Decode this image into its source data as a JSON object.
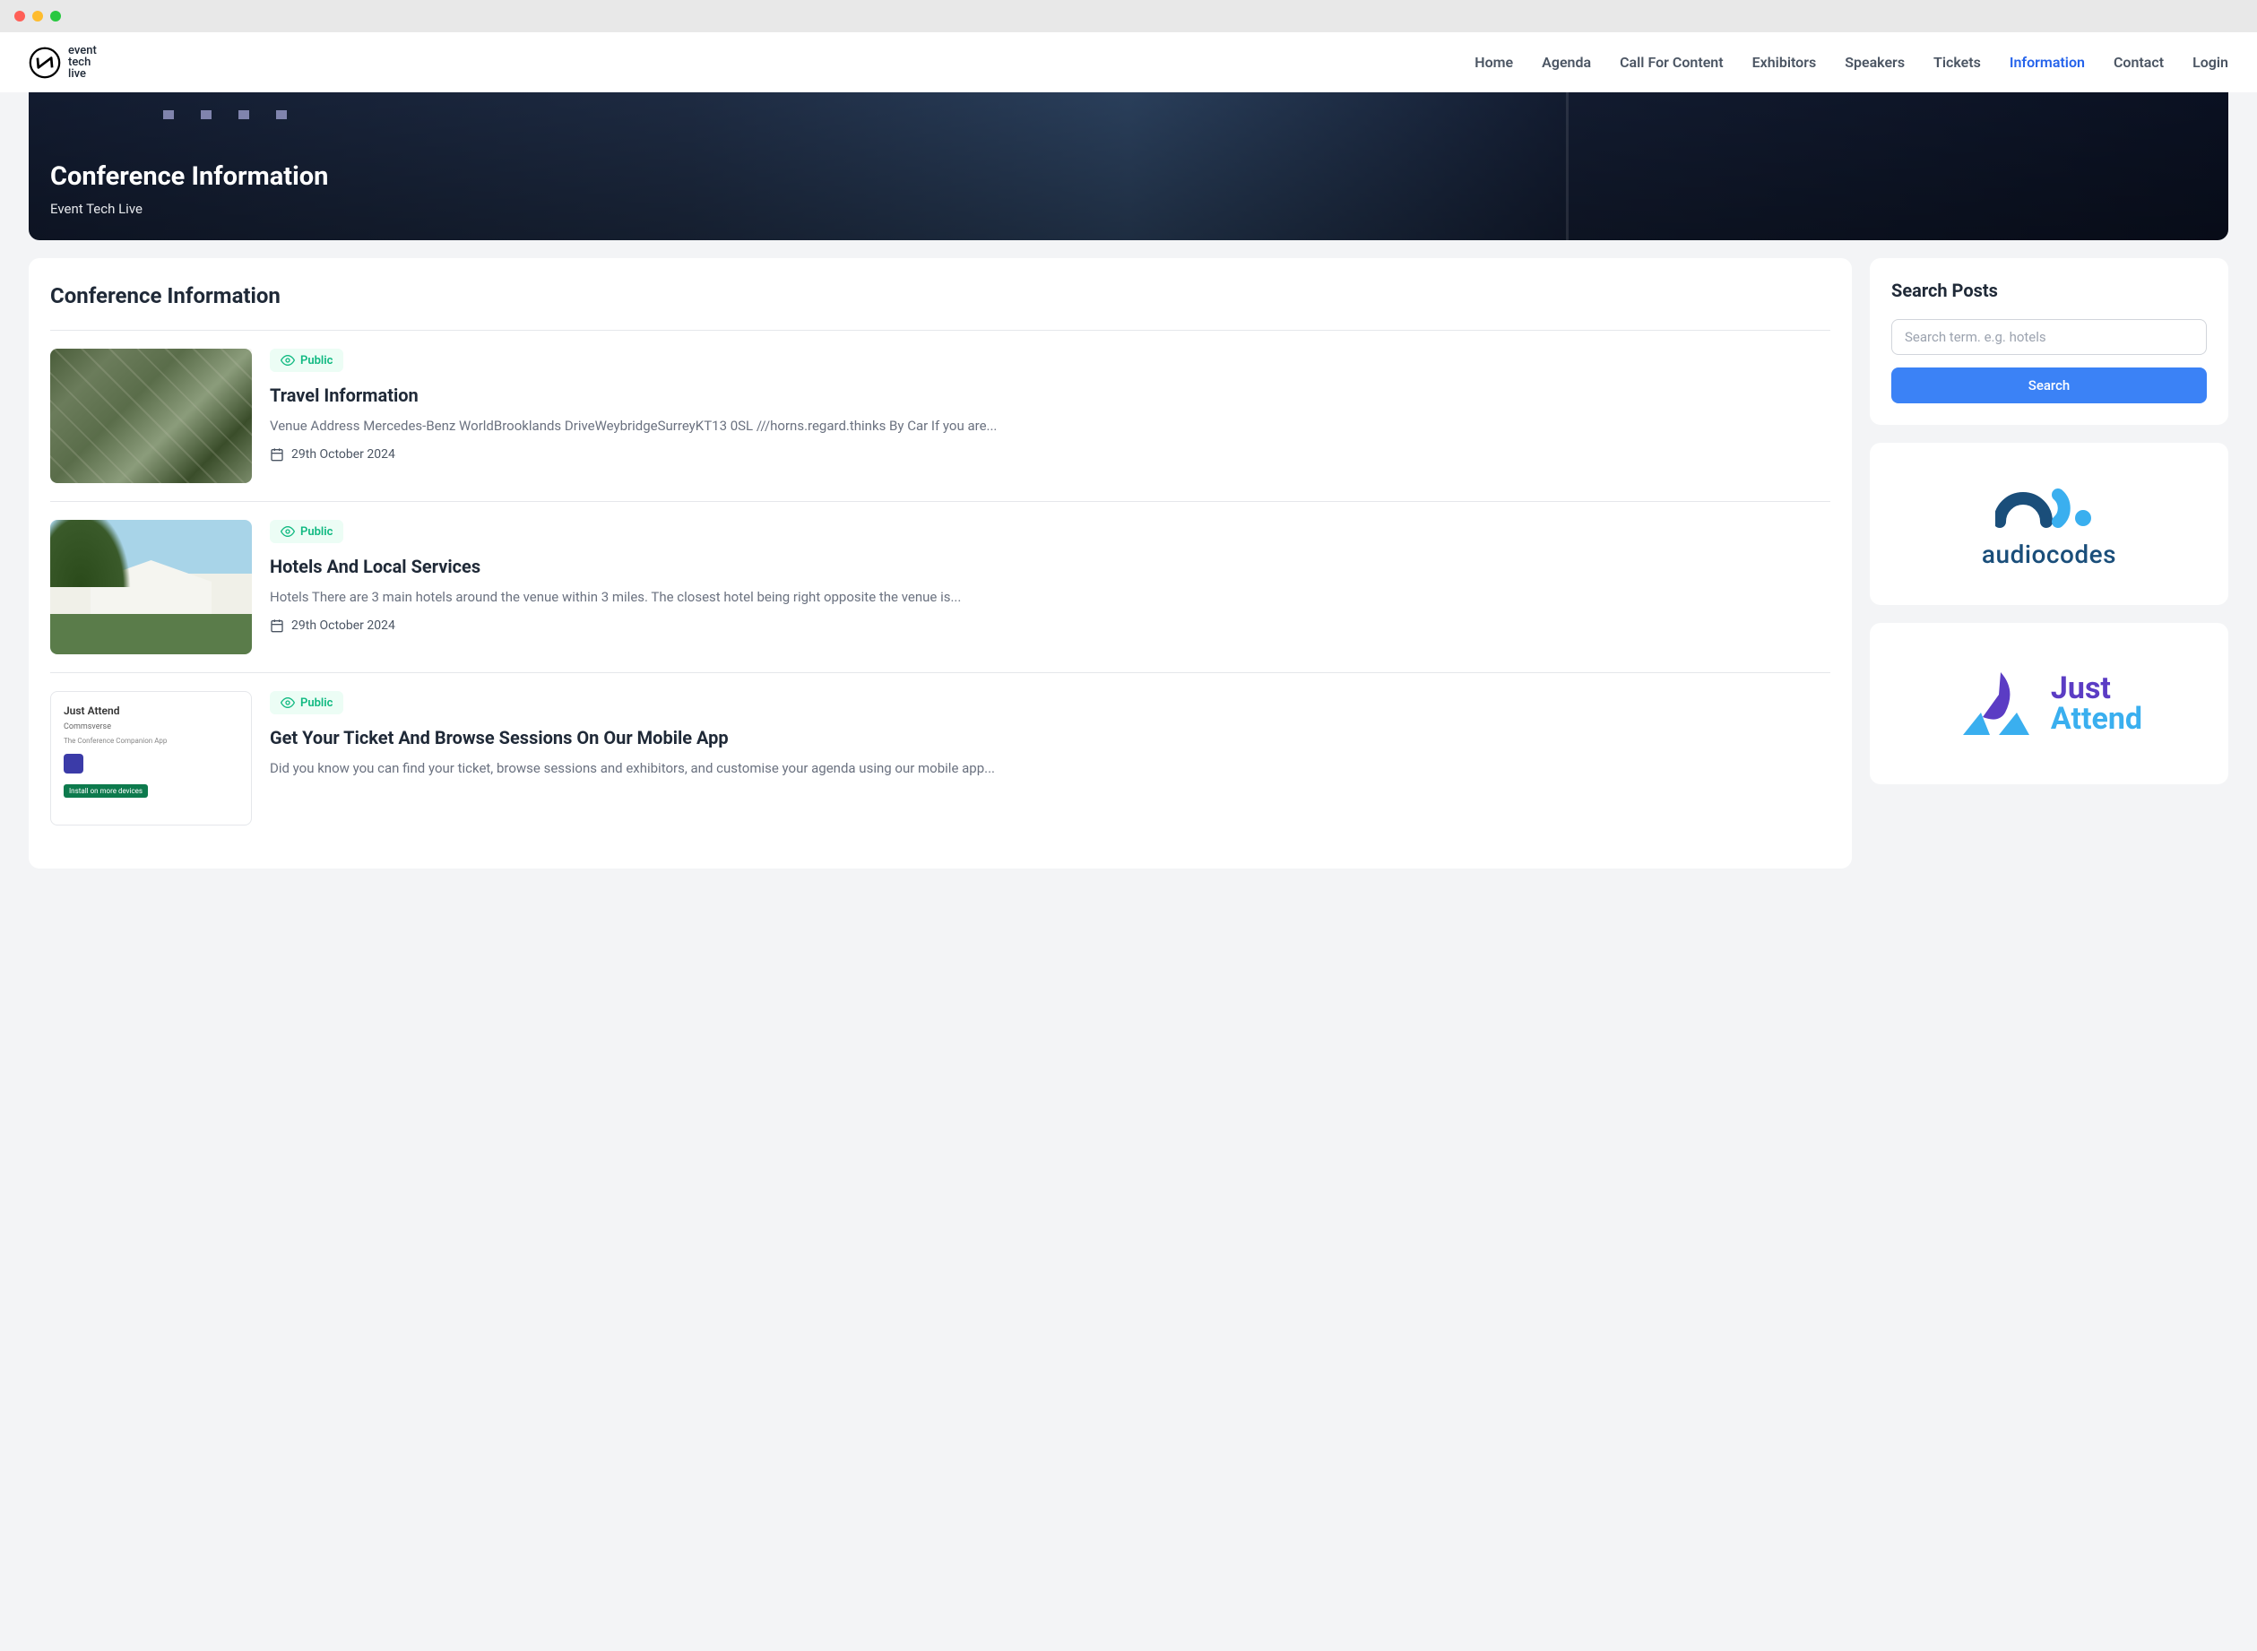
{
  "logo": {
    "line1": "event",
    "line2": "tech",
    "line3": "live"
  },
  "nav": {
    "items": [
      {
        "label": "Home",
        "active": false
      },
      {
        "label": "Agenda",
        "active": false
      },
      {
        "label": "Call For Content",
        "active": false
      },
      {
        "label": "Exhibitors",
        "active": false
      },
      {
        "label": "Speakers",
        "active": false
      },
      {
        "label": "Tickets",
        "active": false
      },
      {
        "label": "Information",
        "active": true
      },
      {
        "label": "Contact",
        "active": false
      },
      {
        "label": "Login",
        "active": false
      }
    ]
  },
  "hero": {
    "title": "Conference Information",
    "subtitle": "Event Tech Live"
  },
  "content": {
    "title": "Conference Information"
  },
  "posts": [
    {
      "badge": "Public",
      "title": "Travel Information",
      "excerpt": "Venue Address Mercedes-Benz WorldBrooklands DriveWeybridgeSurreyKT13 0SL ///horns.regard.thinks By Car If you are...",
      "date": "29th October 2024",
      "imageType": "map"
    },
    {
      "badge": "Public",
      "title": "Hotels And Local Services",
      "excerpt": "Hotels There are 3 main hotels around the venue within 3 miles. The closest hotel being right opposite the venue is...",
      "date": "29th October 2024",
      "imageType": "hotel"
    },
    {
      "badge": "Public",
      "title": "Get Your Ticket And Browse Sessions On Our Mobile App",
      "excerpt": "Did you know you can find your ticket, browse sessions and exhibitors, and customise your agenda using our mobile app...",
      "date": "",
      "imageType": "app"
    }
  ],
  "appThumb": {
    "title": "Just Attend",
    "subtitle": "Commsverse",
    "desc": "The Conference Companion App",
    "install": "Install on more devices"
  },
  "sidebar": {
    "searchTitle": "Search Posts",
    "searchPlaceholder": "Search term. e.g. hotels",
    "searchButton": "Search"
  },
  "sponsors": {
    "audiocodes": "audiocodes",
    "justattend_line1": "Just",
    "justattend_line2": "Attend"
  }
}
